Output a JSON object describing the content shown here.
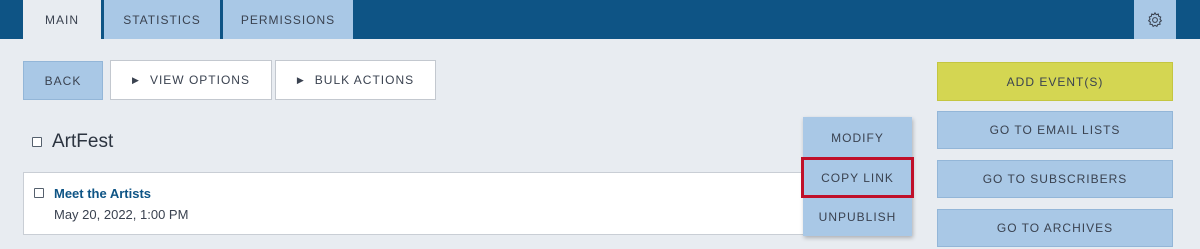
{
  "tabs": [
    {
      "label": "MAIN",
      "active": true
    },
    {
      "label": "STATISTICS",
      "active": false
    },
    {
      "label": "PERMISSIONS",
      "active": false
    }
  ],
  "settings_icon": "gear-icon",
  "toolbar": {
    "back_label": "BACK",
    "view_options_label": "VIEW OPTIONS",
    "bulk_actions_label": "BULK ACTIONS"
  },
  "group": {
    "title": "ArtFest"
  },
  "event": {
    "title": "Meet the Artists",
    "date": "May 20, 2022, 1:00 PM"
  },
  "dropdown": {
    "items": [
      "MODIFY",
      "COPY LINK",
      "UNPUBLISH"
    ],
    "highlighted": "COPY LINK"
  },
  "side_actions": {
    "add_event_label": "ADD EVENT(S)",
    "email_lists_label": "GO TO EMAIL LISTS",
    "subscribers_label": "GO TO SUBSCRIBERS",
    "archives_label": "GO TO ARCHIVES"
  },
  "colors": {
    "topbar": "#0e5485",
    "tab": "#a9c8e6",
    "accent_yellow": "#d4d652",
    "highlight_red": "#c0102a"
  }
}
